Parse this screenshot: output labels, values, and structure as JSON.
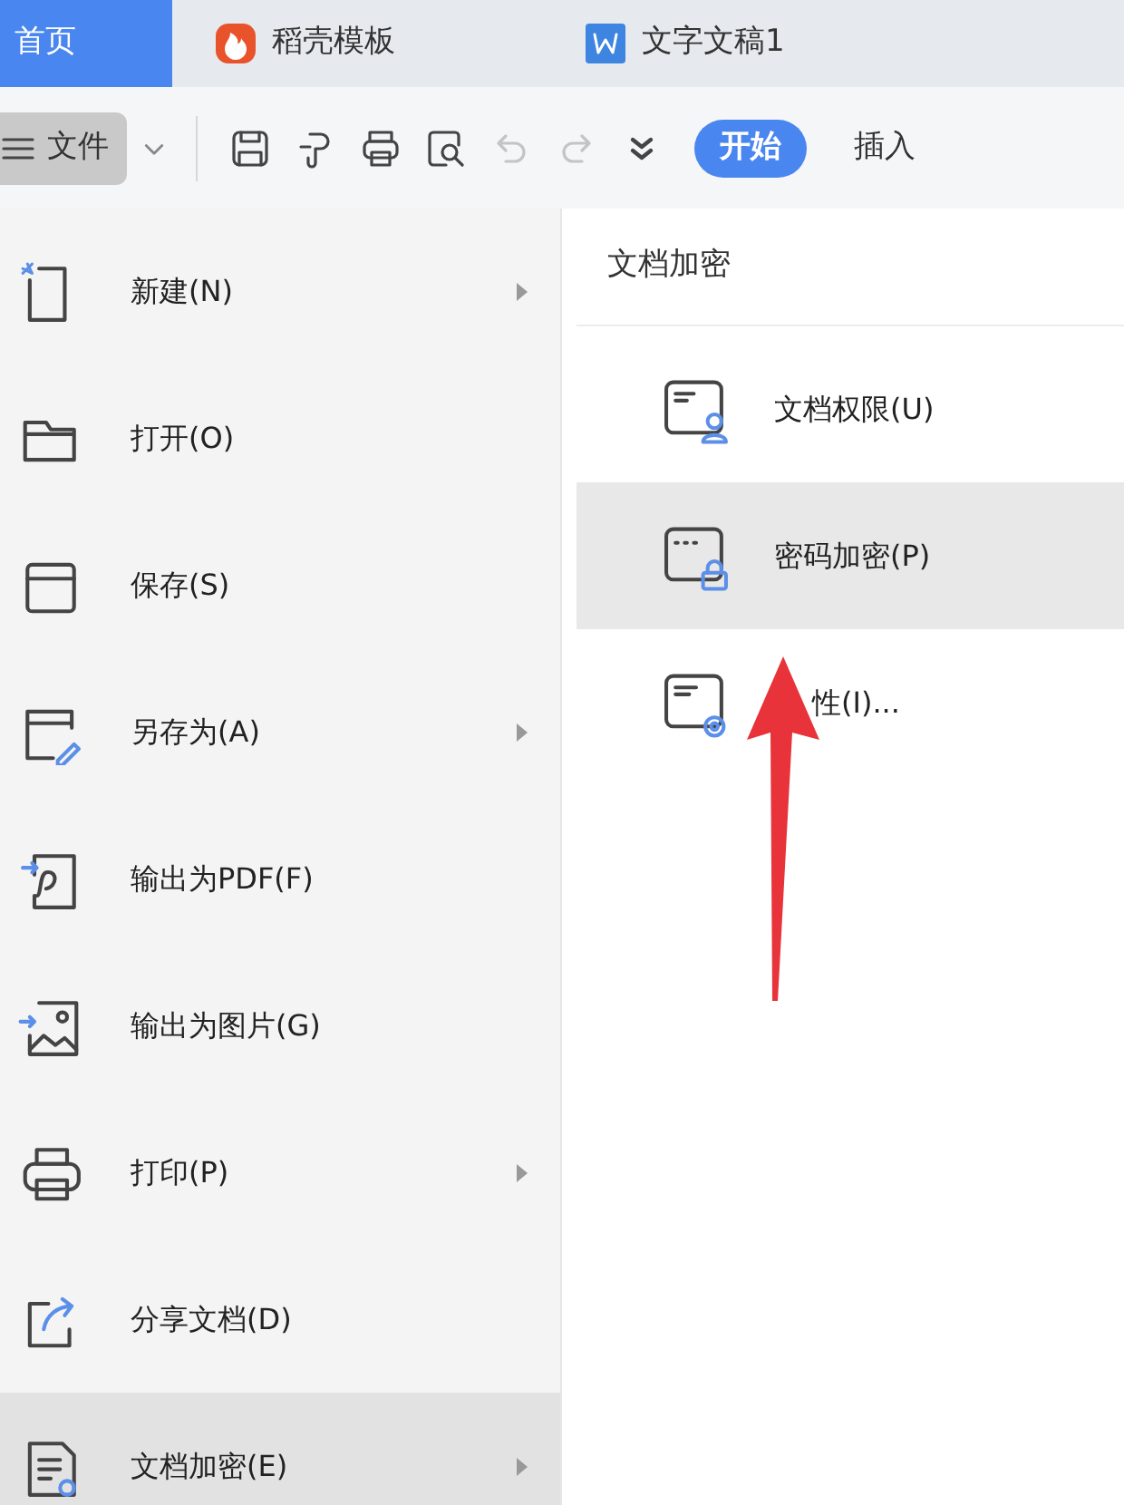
{
  "tabs": [
    {
      "label": "首页",
      "kind": "home",
      "selected": true
    },
    {
      "label": "稻壳模板",
      "kind": "docer",
      "selected": false
    },
    {
      "label": "文字文稿1",
      "kind": "word",
      "selected": false
    }
  ],
  "toolbar": {
    "file_menu": "文件",
    "tools": [
      {
        "kind": "save",
        "disabled": false
      },
      {
        "kind": "painter",
        "disabled": false
      },
      {
        "kind": "print",
        "disabled": false
      },
      {
        "kind": "preview",
        "disabled": false
      },
      {
        "kind": "undo",
        "disabled": true
      },
      {
        "kind": "redo",
        "disabled": true
      },
      {
        "kind": "more",
        "disabled": false
      }
    ],
    "ribbon_tabs": [
      {
        "label": "开始",
        "selected": true
      },
      {
        "label": "插入",
        "selected": false
      }
    ]
  },
  "file_menu": {
    "items": [
      {
        "label": "新建(N)",
        "kind": "new",
        "submenu": true,
        "selected": false
      },
      {
        "label": "打开(O)",
        "kind": "open",
        "submenu": false,
        "selected": false
      },
      {
        "label": "保存(S)",
        "kind": "save",
        "submenu": false,
        "selected": false
      },
      {
        "label": "另存为(A)",
        "kind": "saveas",
        "submenu": true,
        "selected": false
      },
      {
        "label": "输出为PDF(F)",
        "kind": "pdf",
        "submenu": false,
        "selected": false
      },
      {
        "label": "输出为图片(G)",
        "kind": "image",
        "submenu": false,
        "selected": false
      },
      {
        "label": "打印(P)",
        "kind": "print",
        "submenu": true,
        "selected": false
      },
      {
        "label": "分享文档(D)",
        "kind": "share",
        "submenu": false,
        "selected": false
      },
      {
        "label": "文档加密(E)",
        "kind": "encrypt",
        "submenu": true,
        "selected": true
      }
    ]
  },
  "submenu": {
    "title": "文档加密",
    "items": [
      {
        "label": "文档权限(U)",
        "kind": "permission",
        "selected": false
      },
      {
        "label": "密码加密(P)",
        "kind": "password",
        "selected": true
      },
      {
        "label": "性(I)...",
        "kind": "properties",
        "selected": false
      }
    ]
  },
  "annotation": {
    "kind": "arrow"
  }
}
